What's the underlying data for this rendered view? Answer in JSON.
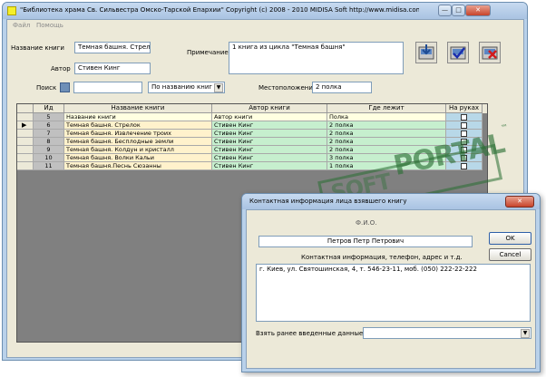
{
  "window": {
    "title": "\"Библиотека храма Св. Сильвестра Омско-Тарской Епархии\" Copyright (c) 2008 - 2010 MIDISA Soft http://www.midisa.com :: v. 2,...",
    "min_glyph": "—",
    "max_glyph": "□",
    "close_glyph": "✕"
  },
  "menu": {
    "items": [
      "Файл",
      "Помощь"
    ]
  },
  "form": {
    "title_label": "Название книги",
    "title_value": "Темная башня. Стрелок",
    "author_label": "Автор",
    "author_value": "Стивен Кинг",
    "note_label": "Примечание",
    "note_value": "1 книга из цикла \"Темная башня\"",
    "search_label": "Поиск",
    "search_value": "",
    "search_mode": "По названию книг",
    "location_label": "Местоположение",
    "location_value": "2 полка"
  },
  "toolbar": {
    "icons": [
      "save-arrow-icon",
      "confirm-check-icon",
      "delete-cross-icon"
    ]
  },
  "grid": {
    "columns": [
      "Ид",
      "Название книги",
      "Автор книги",
      "Где лежит",
      "На руках"
    ],
    "header_row": {
      "id": "5",
      "title": "Название книги",
      "author": "Автор книги",
      "location": "Полка"
    },
    "rows": [
      {
        "id": "6",
        "title": "Темная башня. Стрелок",
        "author": "Стивен Кинг",
        "location": "2 полка",
        "selected": true
      },
      {
        "id": "7",
        "title": "Темная башня. Извлечение троих",
        "author": "Стивен Кинг",
        "location": "2 полка"
      },
      {
        "id": "8",
        "title": "Темная башня. Бесплодные земли",
        "author": "Стивен Кинг",
        "location": "2 полка"
      },
      {
        "id": "9",
        "title": "Темная башня. Колдун и кристалл",
        "author": "Стивен Кинг",
        "location": "2 полка"
      },
      {
        "id": "10",
        "title": "Темная башня. Волки Кальи",
        "author": "Стивен Кинг",
        "location": "3 полка"
      },
      {
        "id": "11",
        "title": "Темная башня.Песнь Сюзанны",
        "author": "Стивен Кинг",
        "location": "1 полка"
      }
    ],
    "selected_marker": "▶"
  },
  "dialog": {
    "title": "Контактная информация лица взявшего книгу",
    "close_glyph": "✕",
    "fio_label": "Ф.И.О.",
    "fio_value": "Петров Петр Петрович",
    "contact_label": "Контактная информация, телефон, адрес и т.д.",
    "contact_value": "г. Киев, ул. Святошинская, 4, т. 546-23-11, моб. (050) 222-22-222",
    "previous_label": "Взять ранее введенные данные:",
    "previous_value": "",
    "ok_label": "OK",
    "cancel_label": "Cancel",
    "dropdown_glyph": "▼"
  },
  "watermark": {
    "brand_left": "SOFT",
    "brand_right": "PORTAL",
    "tm": "™",
    "url": "www.softportal.com"
  },
  "colors": {
    "title_col": "#fff2cc",
    "green_col": "#c6efce",
    "hand_col": "#b8d8e8",
    "id_col": "#c0c0c0",
    "window_frame": "#b9d1ea"
  }
}
